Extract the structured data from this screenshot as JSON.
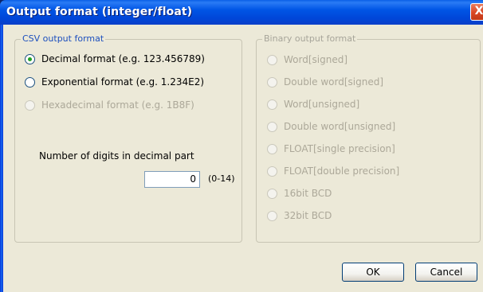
{
  "window": {
    "title": "Output format (integer/float)",
    "close_label": "X"
  },
  "csv": {
    "legend": "CSV output format",
    "options": [
      {
        "label": "Decimal format (e.g. 123.456789)",
        "checked": true,
        "enabled": true
      },
      {
        "label": "Exponential format (e.g. 1.234E2)",
        "checked": false,
        "enabled": true
      },
      {
        "label": "Hexadecimal format (e.g. 1B8F)",
        "checked": false,
        "enabled": false
      }
    ],
    "digits_label": "Number of digits in decimal part",
    "digits_value": "0",
    "digits_range": "(0-14)"
  },
  "binary": {
    "legend": "Binary output format",
    "options": [
      {
        "label": "Word[signed]",
        "enabled": false
      },
      {
        "label": "Double word[signed]",
        "enabled": false
      },
      {
        "label": "Word[unsigned]",
        "enabled": false
      },
      {
        "label": "Double word[unsigned]",
        "enabled": false
      },
      {
        "label": "FLOAT[single precision]",
        "enabled": false
      },
      {
        "label": "FLOAT[double precision]",
        "enabled": false
      },
      {
        "label": "16bit BCD",
        "enabled": false
      },
      {
        "label": "32bit BCD",
        "enabled": false
      }
    ]
  },
  "buttons": {
    "ok": "OK",
    "cancel": "Cancel"
  },
  "colors": {
    "titlebar": "#0055e5",
    "dialog_bg": "#ece9d8",
    "group_legend": "#1c4fbe",
    "disabled_text": "#aca899",
    "radio_dot": "#21a121"
  }
}
